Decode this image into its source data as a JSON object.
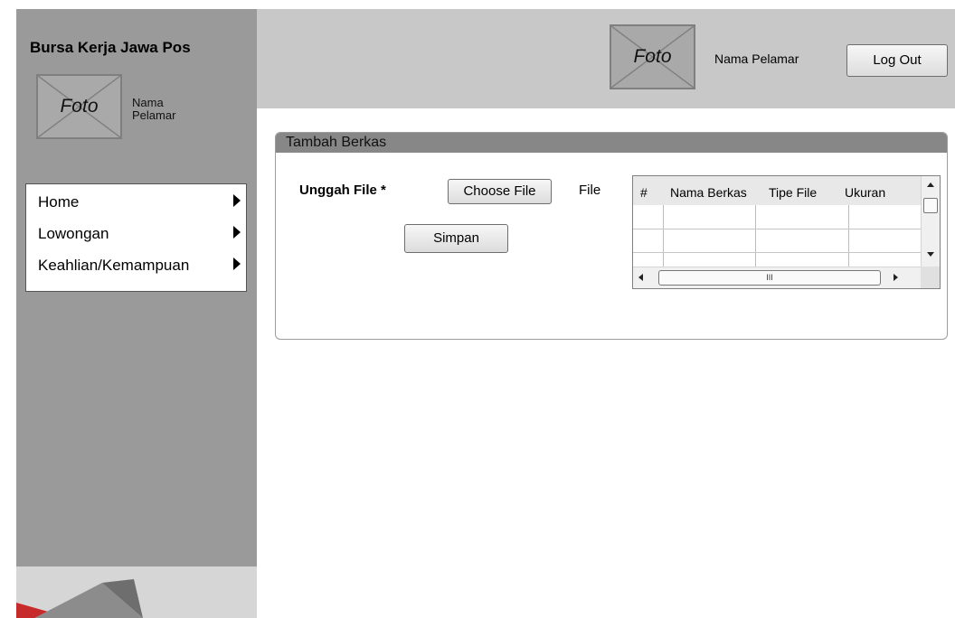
{
  "sidebar": {
    "app_title": "Bursa Kerja Jawa Pos",
    "photo_label": "Foto",
    "user_name": "Nama\nPelamar",
    "menu": [
      {
        "label": "Home"
      },
      {
        "label": "Lowongan"
      },
      {
        "label": "Keahlian/Kemampuan"
      }
    ]
  },
  "header": {
    "photo_label": "Foto",
    "user_name": "Nama Pelamar",
    "logout_label": "Log Out"
  },
  "panel": {
    "title": "Tambah Berkas",
    "upload_label": "Unggah File *",
    "choose_file_label": "Choose File",
    "file_status": "File",
    "save_label": "Simpan",
    "table": {
      "columns": [
        "#",
        "Nama Berkas",
        "Tipe File",
        "Ukuran"
      ],
      "rows": []
    },
    "scrollbar_grip": "III"
  },
  "colors": {
    "sidebar_bg": "#9a9a9a",
    "topbar_bg": "#c8c8c8",
    "panel_header_bg": "#878787"
  }
}
